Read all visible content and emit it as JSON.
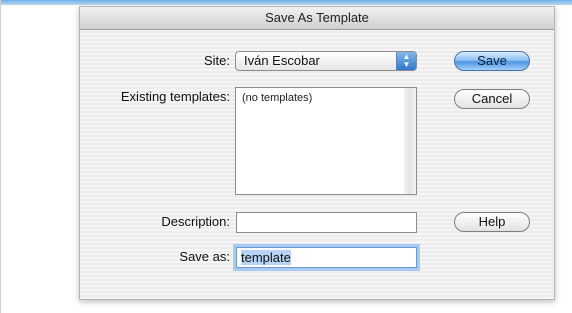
{
  "dialog": {
    "title": "Save As Template",
    "site_label": "Site:",
    "site_value": "Iván Escobar",
    "existing_label": "Existing templates:",
    "existing_items": [
      "(no templates)"
    ],
    "description_label": "Description:",
    "description_value": "",
    "save_as_label": "Save as:",
    "save_as_value": "template",
    "buttons": {
      "save": "Save",
      "cancel": "Cancel",
      "help": "Help"
    }
  }
}
